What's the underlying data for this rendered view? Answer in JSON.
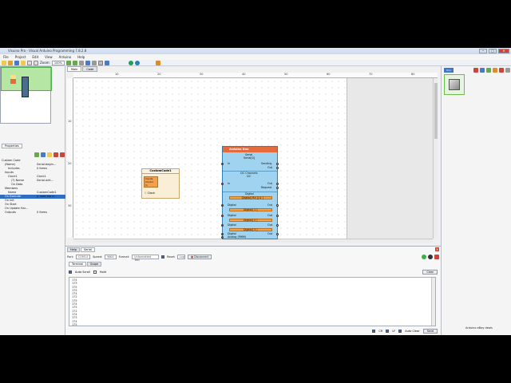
{
  "window": {
    "title": "Visuino Pro - Visual Arduino Programming 7.8.2.8",
    "min": "─",
    "max": "□",
    "close": "✕"
  },
  "menu": [
    "File",
    "Project",
    "Edit",
    "View",
    "Arduino",
    "Help"
  ],
  "toolbar": {
    "zoom_label": "Zoom:",
    "zoom_value": "100%"
  },
  "design_tabs": [
    "Main",
    "Code"
  ],
  "ruler_h": [
    "10",
    "20",
    "30",
    "40",
    "50",
    "60",
    "70",
    "80"
  ],
  "ruler_v": [
    "10",
    "20",
    "30"
  ],
  "left_panel": {
    "tab": "Properties",
    "tree": [
      {
        "label": "Custom Code",
        "indent": 0
      },
      {
        "label": "(Name)",
        "indent": 1
      },
      {
        "label": "Includes",
        "indent": 2
      },
      {
        "label": "Inputs",
        "indent": 1
      },
      {
        "label": "Clock1",
        "indent": 2
      },
      {
        "label": "(?) Name",
        "indent": 3
      },
      {
        "label": "On Data",
        "indent": 3
      },
      {
        "label": "Members",
        "indent": 1
      },
      {
        "label": "Name",
        "indent": 2
      },
      {
        "label": "On Execute",
        "indent": 1,
        "selected": true
      },
      {
        "label": "On Init",
        "indent": 1
      },
      {
        "label": "On Start",
        "indent": 1
      },
      {
        "label": "On Update Har...",
        "indent": 1
      },
      {
        "label": "Outputs",
        "indent": 1
      }
    ],
    "values": [
      {
        "row": 1,
        "text": "Serial.begin..."
      },
      {
        "row": 2,
        "text": "0 Items"
      },
      {
        "row": 4,
        "text": "Clock1"
      },
      {
        "row": 5,
        "text": "Serial.writ..."
      },
      {
        "row": 8,
        "text": "CustomCode1"
      },
      {
        "row": 9,
        "text": "// read the in"
      },
      {
        "row": 13,
        "text": "0 Items"
      }
    ]
  },
  "canvas": {
    "custom_code": {
      "title": "CustomCode1",
      "inner_lines": [
        "Inputs",
        "Clock1",
        "In"
      ],
      "clock_label": "Clock"
    },
    "arduino_uno": {
      "title": "Arduino Uno",
      "serial_label": "Serial",
      "serial0": "Serial[0]",
      "sending": "Sending",
      "in": "In",
      "out": "Out",
      "i2c_label": "I2C Channels",
      "i2c": "I2C",
      "request": "Request",
      "digital_label": "Digital",
      "digital_rx": "Digital[ RX ][ 0 ]",
      "digital_1": "Digital[ 1 ]",
      "digital_2": "Digital[ 2 ]",
      "digital_3": "Digital[ 3 ]",
      "analog_pwm": "Analog (PWM)",
      "digital_text": "Digital"
    }
  },
  "right_panel": {
    "tab": "Uno",
    "status": "Arduino eBay deals"
  },
  "bottom": {
    "tabs": [
      "Help",
      "Serial"
    ],
    "port_label": "Port:",
    "port_value": "COM14",
    "speed_label": "Speed:",
    "speed_value": "9600",
    "format_label": "Format:",
    "format_value": "Unformatted Text",
    "reset_label": "Reset",
    "log_label": "Log",
    "disconnect_label": "Disconnect",
    "subtabs": [
      "Terminal",
      "Scope"
    ],
    "autoscroll_label": "Auto Scroll",
    "hold_label": "Hold",
    "clear_label": "Clear",
    "terminal_lines": [
      "174",
      "173",
      "175",
      "175",
      "174",
      "172",
      "175",
      "174",
      "175",
      "172",
      "174",
      "173",
      "174",
      "175",
      "172",
      "14"
    ],
    "cr_label": "CR",
    "lf_label": "LF",
    "autoclear_label": "Auto Clear",
    "send_label": "Send"
  }
}
